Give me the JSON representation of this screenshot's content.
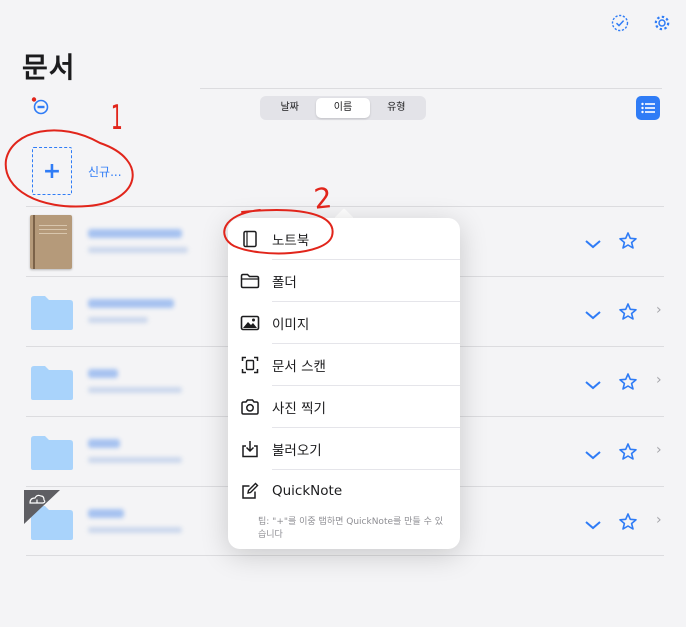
{
  "page_title": "문서",
  "sort_tabs": [
    "날짜",
    "이름",
    "유형"
  ],
  "new_button_label": "신규...",
  "menu": {
    "items": [
      {
        "label": "노트북",
        "icon": "notebook-icon"
      },
      {
        "label": "폴더",
        "icon": "folder-icon"
      },
      {
        "label": "이미지",
        "icon": "image-icon"
      },
      {
        "label": "문서 스캔",
        "icon": "document-scan-icon"
      },
      {
        "label": "사진 찍기",
        "icon": "camera-icon"
      },
      {
        "label": "불러오기",
        "icon": "import-icon"
      },
      {
        "label": "QuickNote",
        "icon": "quicknote-icon"
      }
    ],
    "tip": "팁: \"+\"를 이중 탭하면 QuickNote를 만들 수 있습니다"
  },
  "annotations": {
    "one": "1",
    "two": "2"
  },
  "colors": {
    "accent": "#2f7cf6",
    "annotation": "#e1251b",
    "folder": "#a9d3fb"
  }
}
